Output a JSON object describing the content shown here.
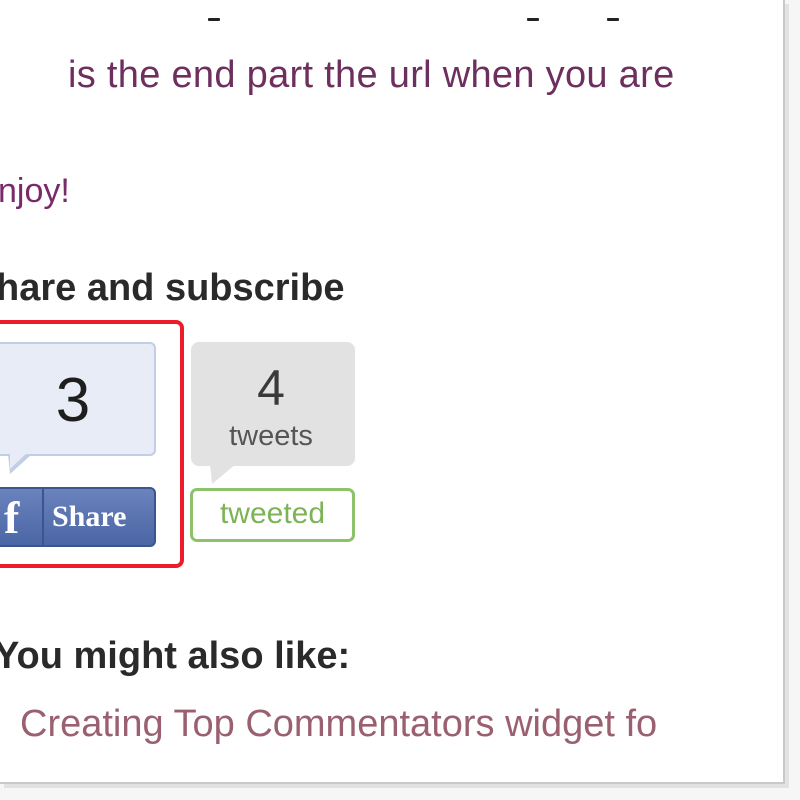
{
  "content": {
    "url_note": "is the end part the url when you are",
    "enjoy": "njoy!",
    "share_heading": "hare and subscribe",
    "related_heading": "You might also like:",
    "related_link": "Creating Top Commentators widget fo"
  },
  "facebook": {
    "count": "3",
    "logo_letter": "f",
    "share_label": "Share",
    "brand_color": "#4b66a5",
    "highlight_color": "#ee1b2a"
  },
  "twitter": {
    "count": "4",
    "unit": "tweets",
    "button_label": "tweeted",
    "accent_color": "#8dc26b"
  },
  "colors": {
    "text_purple": "#6d2f5e",
    "link_mauve": "#9b6070"
  }
}
